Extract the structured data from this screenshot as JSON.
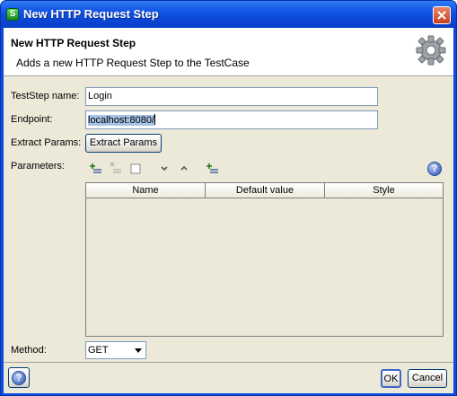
{
  "window": {
    "title": "New HTTP Request Step",
    "icon": "soapui-icon",
    "close_icon": "close-icon"
  },
  "header": {
    "title": "New HTTP Request Step",
    "description": "Adds a new HTTP Request Step to the TestCase",
    "icon": "gear-icon"
  },
  "form": {
    "teststep_name": {
      "label": "TestStep name:",
      "value": "Login"
    },
    "endpoint": {
      "label": "Endpoint:",
      "value": "localhost:8080/"
    },
    "extract_params": {
      "label": "Extract Params:",
      "button_label": "Extract Params"
    },
    "parameters": {
      "label": "Parameters:",
      "toolbar": [
        "add-param-icon",
        "remove-param-icon",
        "clear-icon",
        "move-down-icon",
        "move-up-icon",
        "add-from-query-icon",
        "help-icon"
      ],
      "columns": [
        "Name",
        "Default value",
        "Style"
      ],
      "rows": []
    },
    "method": {
      "label": "Method:",
      "value": "GET"
    }
  },
  "footer": {
    "help_label": "?",
    "ok_label": "OK",
    "cancel_label": "Cancel"
  },
  "colors": {
    "titlebar": "#0a4de0",
    "dialog_bg": "#ece9d8",
    "selection": "#a6c2e6"
  }
}
